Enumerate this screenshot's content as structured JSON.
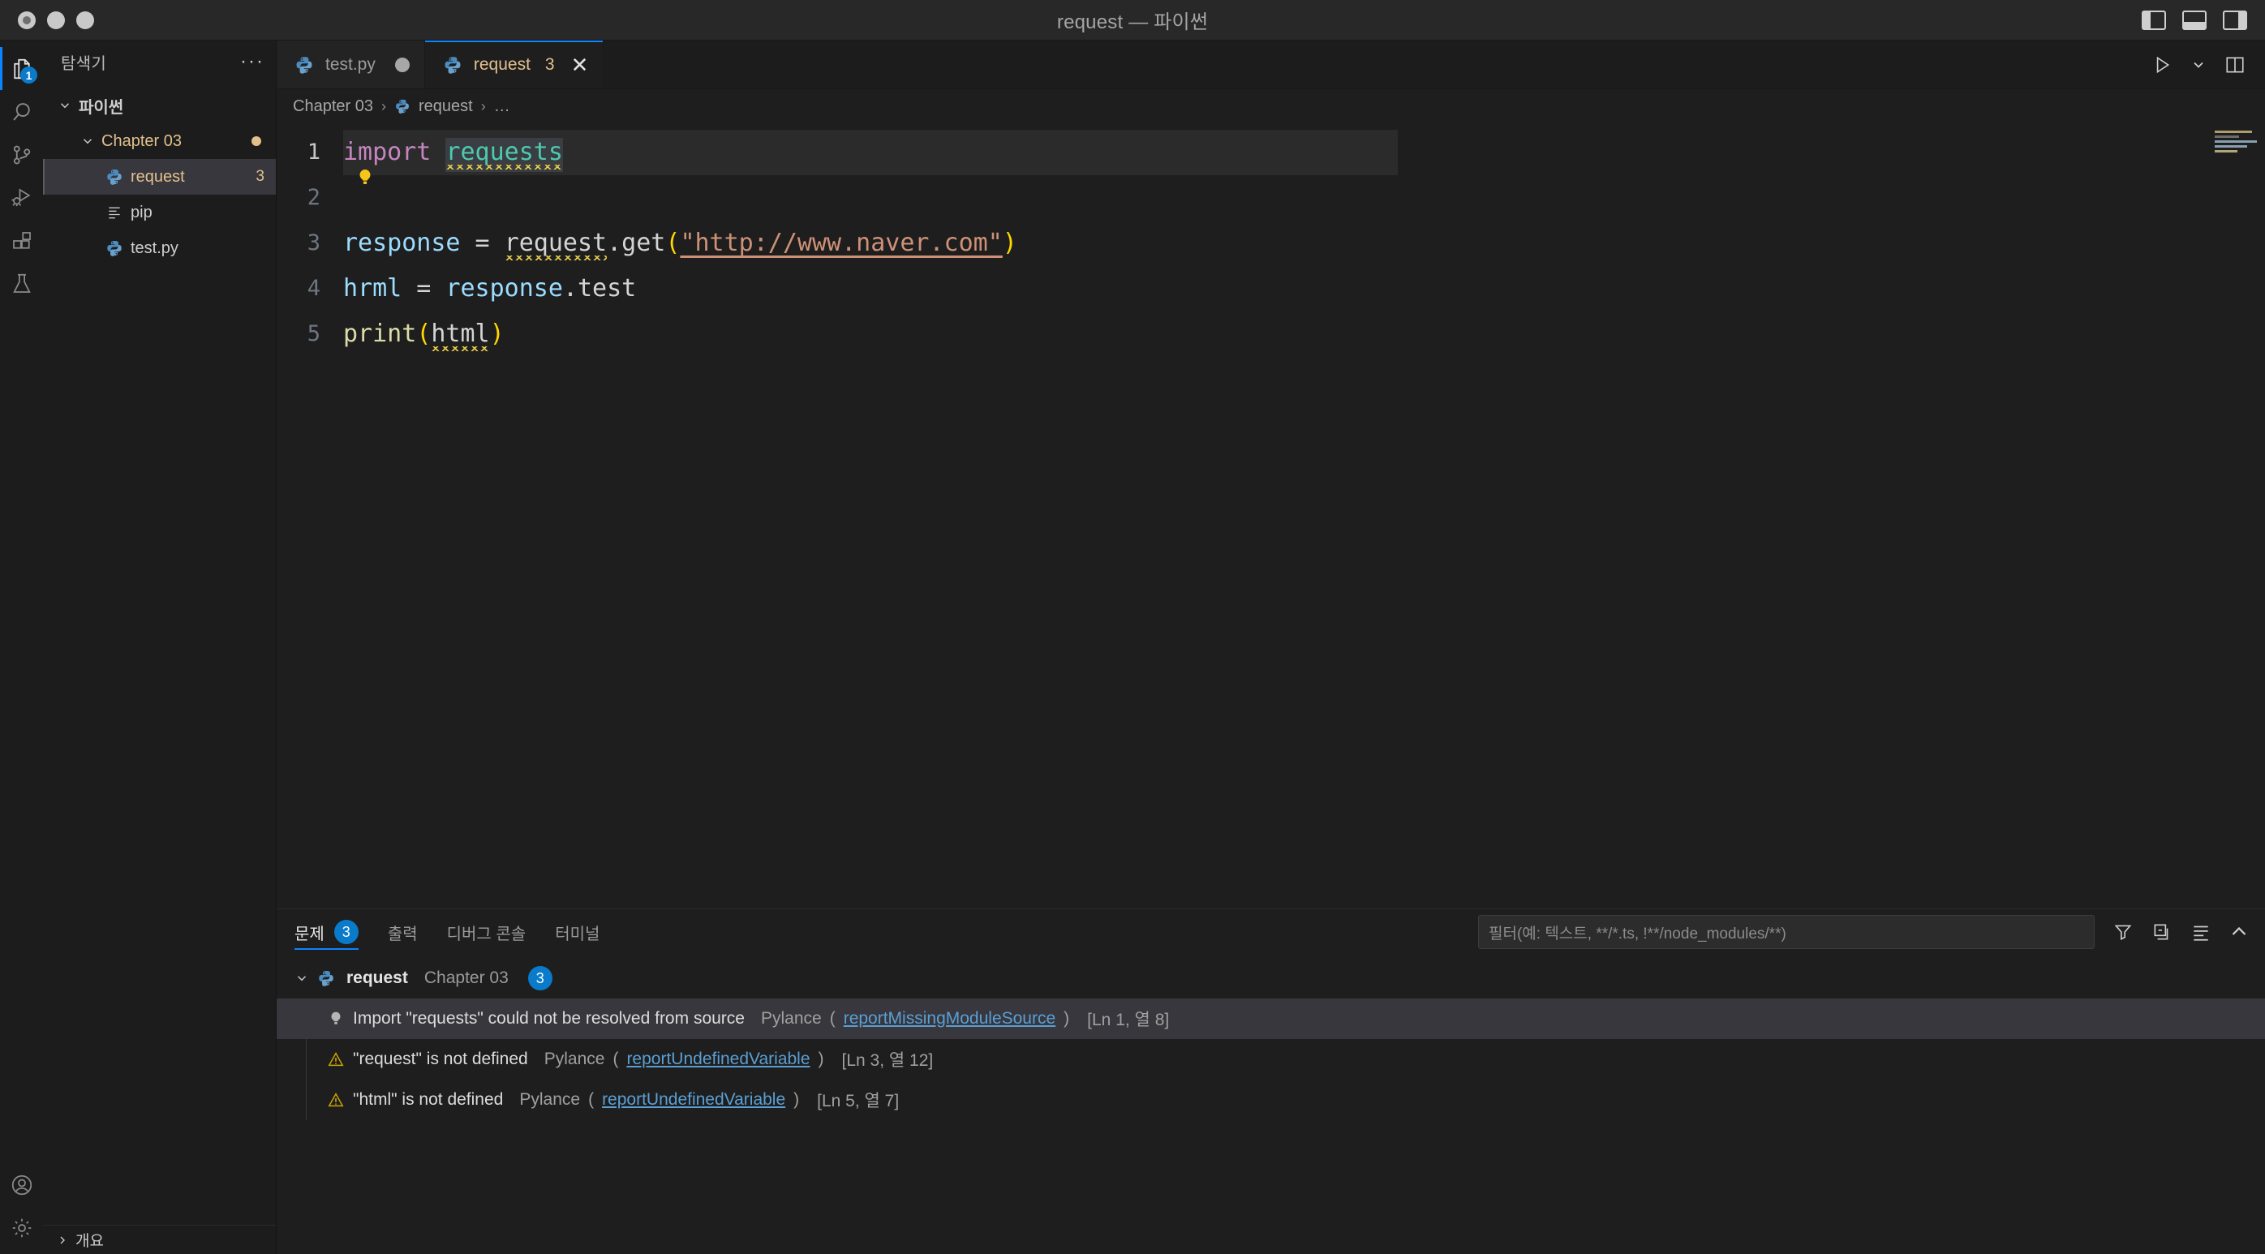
{
  "window": {
    "title": "request — 파이썬",
    "traffic_lights": [
      "close",
      "minimize",
      "maximize"
    ],
    "layout_toggles": [
      "toggle-primary-sidebar",
      "toggle-panel",
      "toggle-secondary-sidebar"
    ]
  },
  "activity_bar": {
    "items": [
      {
        "name": "explorer",
        "icon": "files-icon",
        "badge": "1",
        "active": true
      },
      {
        "name": "search",
        "icon": "search-icon",
        "badge": "",
        "active": false
      },
      {
        "name": "source-control",
        "icon": "source-control-icon",
        "badge": "",
        "active": false
      },
      {
        "name": "run-and-debug",
        "icon": "run-debug-icon",
        "badge": "",
        "active": false
      },
      {
        "name": "extensions",
        "icon": "extensions-icon",
        "badge": "",
        "active": false
      },
      {
        "name": "testing",
        "icon": "beaker-icon",
        "badge": "",
        "active": false
      }
    ],
    "bottom_items": [
      {
        "name": "accounts",
        "icon": "account-icon"
      },
      {
        "name": "manage",
        "icon": "gear-icon"
      }
    ]
  },
  "sidebar": {
    "title": "탐색기",
    "more_actions": "···",
    "tree": [
      {
        "label": "파이썬",
        "indent": 0,
        "type": "root-folder",
        "expanded": true,
        "bold": true,
        "color": "default",
        "badge": "",
        "dot": false
      },
      {
        "label": "Chapter 03",
        "indent": 1,
        "type": "folder",
        "expanded": true,
        "bold": false,
        "color": "gold",
        "badge": "",
        "dot": true
      },
      {
        "label": "request",
        "indent": 2,
        "type": "python-file",
        "expanded": null,
        "bold": false,
        "color": "gold",
        "badge": "3",
        "dot": false,
        "selected": true
      },
      {
        "label": "pip",
        "indent": 2,
        "type": "text-file",
        "expanded": null,
        "bold": false,
        "color": "default",
        "badge": "",
        "dot": false
      },
      {
        "label": "test.py",
        "indent": 2,
        "type": "python-file",
        "expanded": null,
        "bold": false,
        "color": "default",
        "badge": "",
        "dot": false
      }
    ],
    "footer": {
      "label": "개요",
      "icon": "chevron-right-icon"
    }
  },
  "editor": {
    "tabs": [
      {
        "label": "test.py",
        "icon": "python-icon",
        "dirty": true,
        "count": "",
        "active": false,
        "closable": false
      },
      {
        "label": "request",
        "icon": "python-icon",
        "dirty": false,
        "count": "3",
        "active": true,
        "closable": true,
        "close_glyph": "✕"
      }
    ],
    "tab_actions": [
      {
        "name": "run-python-file",
        "icon": "play-icon"
      },
      {
        "name": "run-options-dropdown",
        "icon": "chevron-down-icon"
      },
      {
        "name": "split-editor",
        "icon": "split-editor-icon"
      }
    ],
    "breadcrumb": [
      {
        "label": "Chapter 03",
        "icon": ""
      },
      {
        "label": "request",
        "icon": "python-icon"
      },
      {
        "label": "…",
        "icon": ""
      }
    ],
    "breadcrumb_separator": "›",
    "lightbulb_line": 2,
    "lines": [
      {
        "number": "1",
        "current": true,
        "tokens": [
          {
            "text": "import",
            "style": "kw"
          },
          {
            "text": " ",
            "style": "plain"
          },
          {
            "text": "requests",
            "style": "mod selected squiggle"
          }
        ]
      },
      {
        "number": "2",
        "current": false,
        "tokens": []
      },
      {
        "number": "3",
        "current": false,
        "tokens": [
          {
            "text": "response",
            "style": "var"
          },
          {
            "text": " = ",
            "style": "plain"
          },
          {
            "text": "request",
            "style": "plain squiggle"
          },
          {
            "text": ".get",
            "style": "plain"
          },
          {
            "text": "(",
            "style": "paren"
          },
          {
            "text": "\"http://www.naver.com\"",
            "style": "str link"
          },
          {
            "text": ")",
            "style": "paren"
          }
        ]
      },
      {
        "number": "4",
        "current": false,
        "tokens": [
          {
            "text": "hrml",
            "style": "var"
          },
          {
            "text": " = ",
            "style": "plain"
          },
          {
            "text": "response",
            "style": "var"
          },
          {
            "text": ".test",
            "style": "plain"
          }
        ]
      },
      {
        "number": "5",
        "current": false,
        "tokens": [
          {
            "text": "print",
            "style": "fn"
          },
          {
            "text": "(",
            "style": "paren"
          },
          {
            "text": "html",
            "style": "plain squiggle"
          },
          {
            "text": ")",
            "style": "paren"
          }
        ]
      }
    ]
  },
  "panel": {
    "tabs": [
      {
        "label": "문제",
        "badge": "3",
        "active": true
      },
      {
        "label": "출력",
        "badge": "",
        "active": false
      },
      {
        "label": "디버그 콘솔",
        "badge": "",
        "active": false
      },
      {
        "label": "터미널",
        "badge": "",
        "active": false
      }
    ],
    "filter": {
      "placeholder": "필터(예: 텍스트, **/*.ts, !**/node_modules/**)",
      "value": ""
    },
    "toolbar": [
      {
        "name": "filter-icon",
        "label": "필터"
      },
      {
        "name": "collapse-all-icon",
        "label": "모두 축소"
      },
      {
        "name": "view-as-table-icon",
        "label": "테이블로 보기"
      },
      {
        "name": "chevron-up-icon",
        "label": "패널 최대화"
      }
    ],
    "group": {
      "expanded": true,
      "icon": "python-icon",
      "file": "request",
      "folder": "Chapter 03",
      "count": "3"
    },
    "problems": [
      {
        "severity": "hint",
        "icon": "lightbulb-icon",
        "message": "Import \"requests\" could not be resolved from source",
        "source": "Pylance",
        "code": "reportMissingModuleSource",
        "location": "[Ln 1, 열 8]",
        "selected": true
      },
      {
        "severity": "warning",
        "icon": "warning-icon",
        "message": "\"request\" is not defined",
        "source": "Pylance",
        "code": "reportUndefinedVariable",
        "location": "[Ln 3, 열 12]",
        "selected": false
      },
      {
        "severity": "warning",
        "icon": "warning-icon",
        "message": "\"html\" is not defined",
        "source": "Pylance",
        "code": "reportUndefinedVariable",
        "location": "[Ln 5, 열 7]",
        "selected": false
      }
    ]
  },
  "colors": {
    "accent": "#0a84ff",
    "modified_gold": "#e2c08d",
    "badge_blue": "#0a7aca",
    "warning": "#cca700",
    "link": "#5a9fd4",
    "editor_bg": "#1e1e1e",
    "sidebar_bg": "#1c1c1c"
  }
}
